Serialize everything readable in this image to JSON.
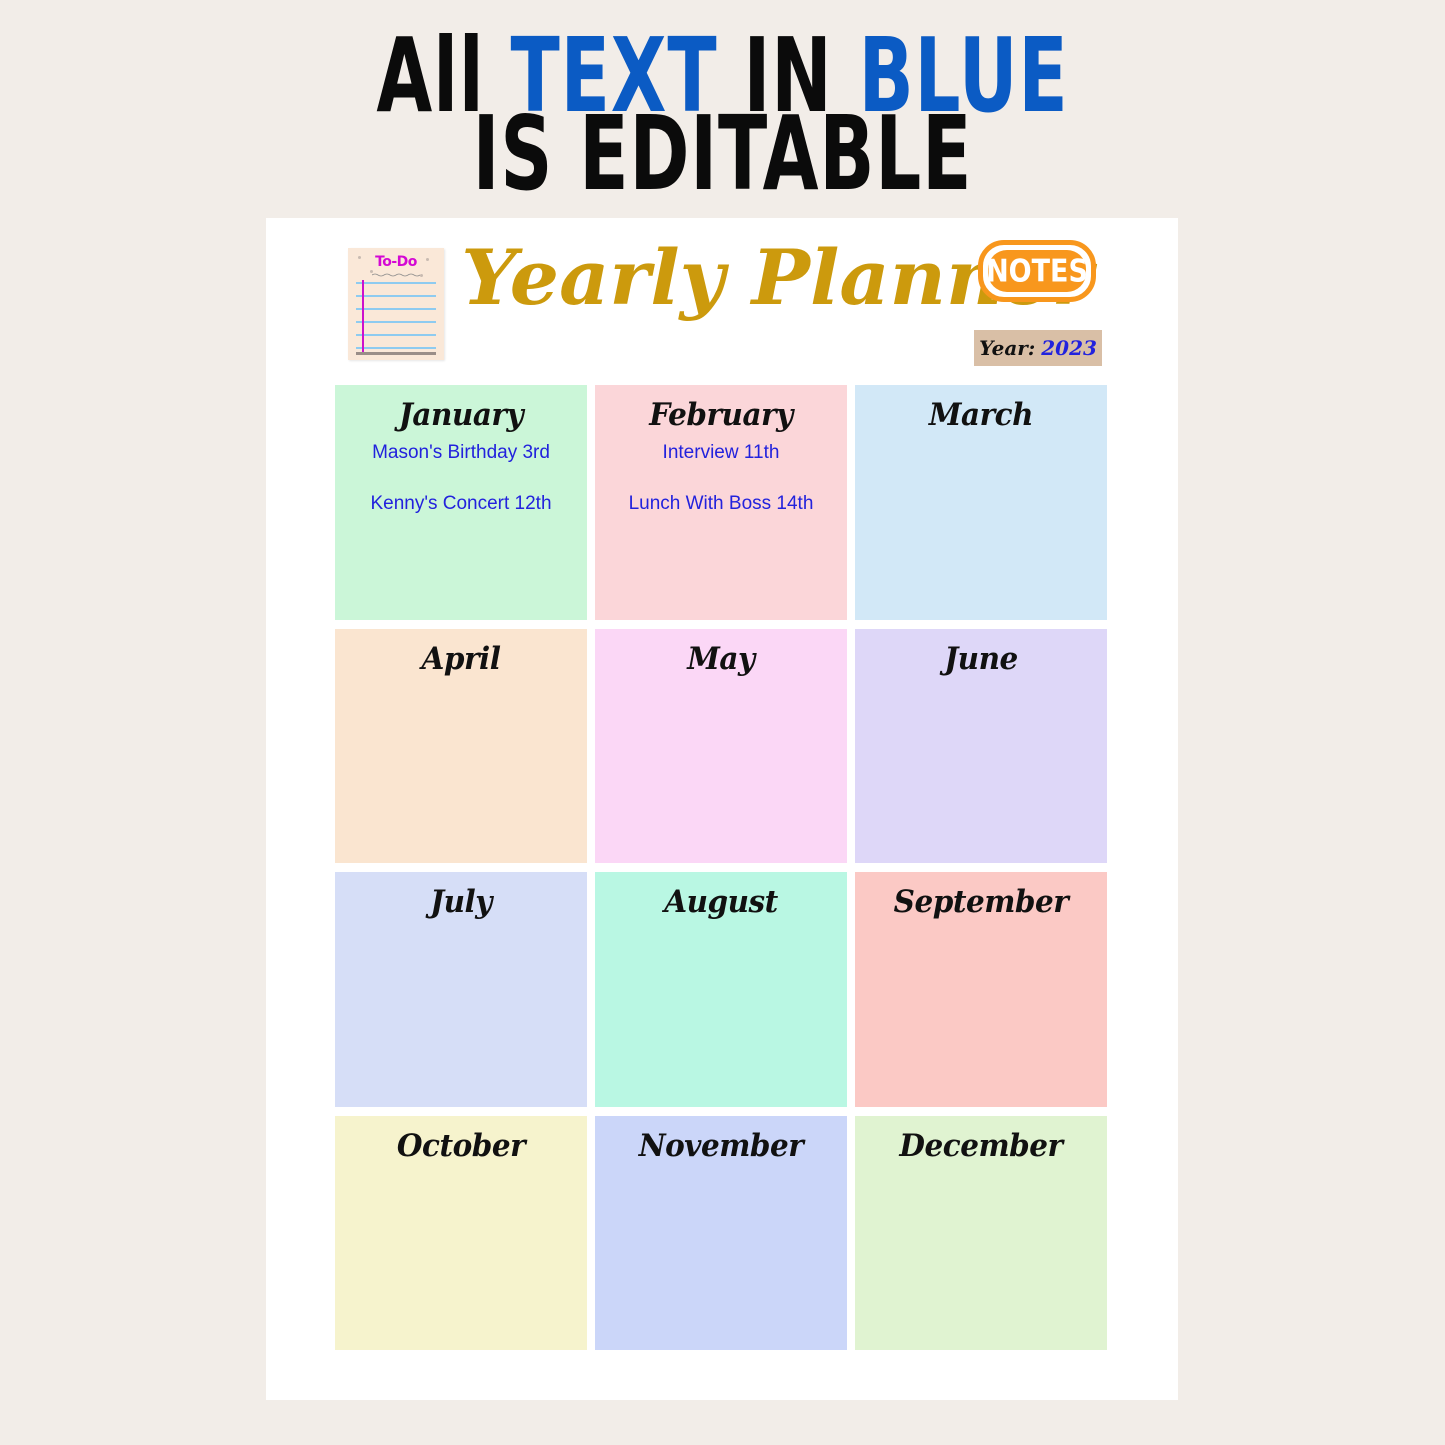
{
  "banner": {
    "line1_part1": "All ",
    "line1_kw1": "TEXT",
    "line1_part2": " IN ",
    "line1_kw2": "BLUE",
    "line2": "IS EDITABLE",
    "black_color": "#0B0B0B",
    "blue_color": "#0B5BC4"
  },
  "planner": {
    "title": "Yearly Planner",
    "title_color": "#CC9A0D",
    "todo_note": {
      "label": "To-Do",
      "label_color": "#D408D4",
      "paper_color": "#FAE8D8",
      "rule_color": "#8ECBF0",
      "margin_color": "#CC11CC"
    },
    "notes_badge": {
      "label": "NOTES",
      "accent_color": "#F8971D",
      "text_color": "#FFFFFF"
    },
    "year_field": {
      "label": "Year:",
      "value": "2023",
      "background_color": "#D9BFA6",
      "value_color": "#2222DD"
    },
    "event_text_color": "#2222DD",
    "page_background": "#FFFFFF",
    "canvas_background": "#F2EDE8"
  },
  "months": [
    {
      "name": "January",
      "color": "#CBF6D8",
      "events": [
        "Mason's Birthday 3rd",
        "Kenny's Concert 12th"
      ]
    },
    {
      "name": "February",
      "color": "#FBD6D9",
      "events": [
        "Interview 11th",
        "Lunch With Boss 14th"
      ]
    },
    {
      "name": "March",
      "color": "#D2E8F7",
      "events": []
    },
    {
      "name": "April",
      "color": "#FAE5D0",
      "events": []
    },
    {
      "name": "May",
      "color": "#FBD7F6",
      "events": []
    },
    {
      "name": "June",
      "color": "#DED7F8",
      "events": []
    },
    {
      "name": "July",
      "color": "#D6DEF7",
      "events": []
    },
    {
      "name": "August",
      "color": "#B9F7E3",
      "events": []
    },
    {
      "name": "September",
      "color": "#FBC9C5",
      "events": []
    },
    {
      "name": "October",
      "color": "#F6F3CD",
      "events": []
    },
    {
      "name": "November",
      "color": "#CBD6F9",
      "events": []
    },
    {
      "name": "December",
      "color": "#E0F3D1",
      "events": []
    }
  ]
}
